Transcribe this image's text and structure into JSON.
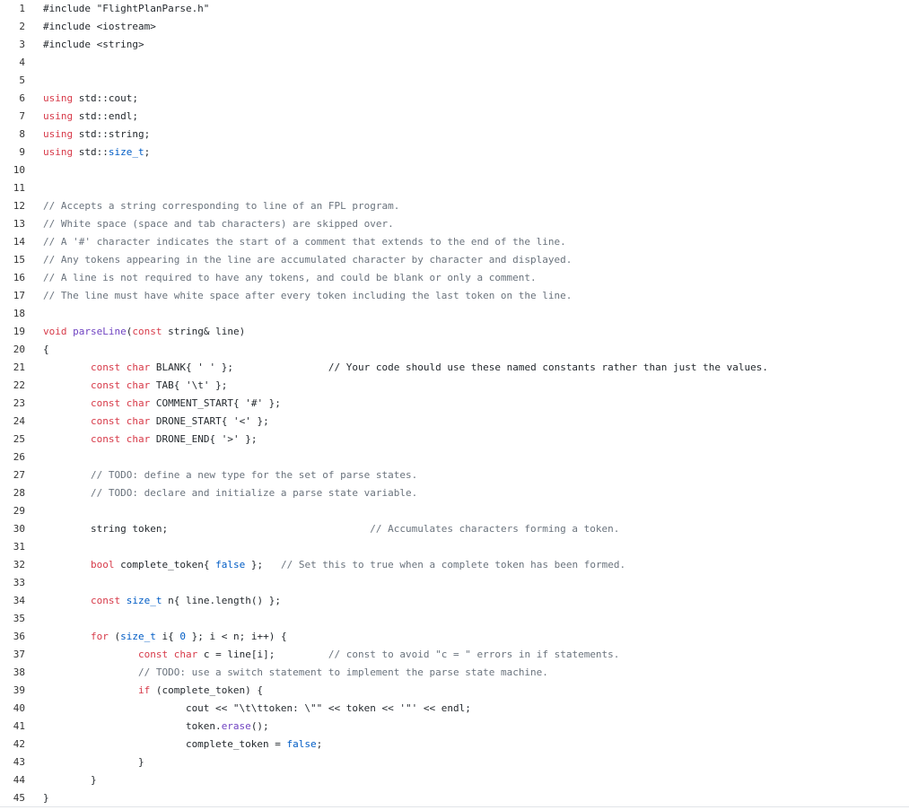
{
  "lines": [
    {
      "n": "1",
      "segs": [
        {
          "t": "#include \"FlightPlanParse.h\"",
          "c": "st"
        }
      ]
    },
    {
      "n": "2",
      "segs": [
        {
          "t": "#include <iostream>",
          "c": "st"
        }
      ]
    },
    {
      "n": "3",
      "segs": [
        {
          "t": "#include <string>",
          "c": "st"
        }
      ]
    },
    {
      "n": "4",
      "segs": []
    },
    {
      "n": "5",
      "segs": []
    },
    {
      "n": "6",
      "segs": [
        {
          "t": "using",
          "c": "kw"
        },
        {
          "t": " std::cout;",
          "c": "st"
        }
      ]
    },
    {
      "n": "7",
      "segs": [
        {
          "t": "using",
          "c": "kw"
        },
        {
          "t": " std::endl;",
          "c": "st"
        }
      ]
    },
    {
      "n": "8",
      "segs": [
        {
          "t": "using",
          "c": "kw"
        },
        {
          "t": " std::string;",
          "c": "st"
        }
      ]
    },
    {
      "n": "9",
      "segs": [
        {
          "t": "using",
          "c": "kw"
        },
        {
          "t": " std::",
          "c": "st"
        },
        {
          "t": "size_t",
          "c": "bl"
        },
        {
          "t": ";",
          "c": "st"
        }
      ]
    },
    {
      "n": "10",
      "segs": []
    },
    {
      "n": "11",
      "segs": []
    },
    {
      "n": "12",
      "segs": [
        {
          "t": "// Accepts a string corresponding to line of an FPL program.",
          "c": "cm"
        }
      ]
    },
    {
      "n": "13",
      "segs": [
        {
          "t": "// White space (space and tab characters) are skipped over.",
          "c": "cm"
        }
      ]
    },
    {
      "n": "14",
      "segs": [
        {
          "t": "// A '#' character indicates the start of a comment that extends to the end of the line.",
          "c": "cm"
        }
      ]
    },
    {
      "n": "15",
      "segs": [
        {
          "t": "// Any tokens appearing in the line are accumulated character by character and displayed.",
          "c": "cm"
        }
      ]
    },
    {
      "n": "16",
      "segs": [
        {
          "t": "// A line is not required to have any tokens, and could be blank or only a comment.",
          "c": "cm"
        }
      ]
    },
    {
      "n": "17",
      "segs": [
        {
          "t": "// The line must have white space after every token including the last token on the line.",
          "c": "cm"
        }
      ]
    },
    {
      "n": "18",
      "segs": []
    },
    {
      "n": "19",
      "segs": [
        {
          "t": "void",
          "c": "kw"
        },
        {
          "t": " ",
          "c": "st"
        },
        {
          "t": "parseLine",
          "c": "fn"
        },
        {
          "t": "(",
          "c": "st"
        },
        {
          "t": "const",
          "c": "kw"
        },
        {
          "t": " string& line)",
          "c": "st"
        }
      ]
    },
    {
      "n": "20",
      "segs": [
        {
          "t": "{",
          "c": "st"
        }
      ]
    },
    {
      "n": "21",
      "segs": [
        {
          "t": "        ",
          "c": "st"
        },
        {
          "t": "const",
          "c": "kw"
        },
        {
          "t": " ",
          "c": "st"
        },
        {
          "t": "char",
          "c": "kw"
        },
        {
          "t": " BLANK{ ' ' };                // Your code should use these named constants rather than just the values.",
          "c": "st"
        }
      ]
    },
    {
      "n": "22",
      "segs": [
        {
          "t": "        ",
          "c": "st"
        },
        {
          "t": "const",
          "c": "kw"
        },
        {
          "t": " ",
          "c": "st"
        },
        {
          "t": "char",
          "c": "kw"
        },
        {
          "t": " TAB{ '\\t' };",
          "c": "st"
        }
      ]
    },
    {
      "n": "23",
      "segs": [
        {
          "t": "        ",
          "c": "st"
        },
        {
          "t": "const",
          "c": "kw"
        },
        {
          "t": " ",
          "c": "st"
        },
        {
          "t": "char",
          "c": "kw"
        },
        {
          "t": " COMMENT_START{ '#' };",
          "c": "st"
        }
      ]
    },
    {
      "n": "24",
      "segs": [
        {
          "t": "        ",
          "c": "st"
        },
        {
          "t": "const",
          "c": "kw"
        },
        {
          "t": " ",
          "c": "st"
        },
        {
          "t": "char",
          "c": "kw"
        },
        {
          "t": " DRONE_START{ '<' };",
          "c": "st"
        }
      ]
    },
    {
      "n": "25",
      "segs": [
        {
          "t": "        ",
          "c": "st"
        },
        {
          "t": "const",
          "c": "kw"
        },
        {
          "t": " ",
          "c": "st"
        },
        {
          "t": "char",
          "c": "kw"
        },
        {
          "t": " DRONE_END{ '>' };",
          "c": "st"
        }
      ]
    },
    {
      "n": "26",
      "segs": []
    },
    {
      "n": "27",
      "segs": [
        {
          "t": "        ",
          "c": "st"
        },
        {
          "t": "// TODO: define a new type for the set of parse states.",
          "c": "cm"
        }
      ]
    },
    {
      "n": "28",
      "segs": [
        {
          "t": "        ",
          "c": "st"
        },
        {
          "t": "// TODO: declare and initialize a parse state variable.",
          "c": "cm"
        }
      ]
    },
    {
      "n": "29",
      "segs": []
    },
    {
      "n": "30",
      "segs": [
        {
          "t": "        string token;                                  ",
          "c": "st"
        },
        {
          "t": "// Accumulates characters forming a token.",
          "c": "cm"
        }
      ]
    },
    {
      "n": "31",
      "segs": []
    },
    {
      "n": "32",
      "segs": [
        {
          "t": "        ",
          "c": "st"
        },
        {
          "t": "bool",
          "c": "kw"
        },
        {
          "t": " complete_token{ ",
          "c": "st"
        },
        {
          "t": "false",
          "c": "bl"
        },
        {
          "t": " };   ",
          "c": "st"
        },
        {
          "t": "// Set this to true when a complete token has been formed.",
          "c": "cm"
        }
      ]
    },
    {
      "n": "33",
      "segs": []
    },
    {
      "n": "34",
      "segs": [
        {
          "t": "        ",
          "c": "st"
        },
        {
          "t": "const",
          "c": "kw"
        },
        {
          "t": " ",
          "c": "st"
        },
        {
          "t": "size_t",
          "c": "bl"
        },
        {
          "t": " n{ line.length() };",
          "c": "st"
        }
      ]
    },
    {
      "n": "35",
      "segs": []
    },
    {
      "n": "36",
      "segs": [
        {
          "t": "        ",
          "c": "st"
        },
        {
          "t": "for",
          "c": "kw"
        },
        {
          "t": " (",
          "c": "st"
        },
        {
          "t": "size_t",
          "c": "bl"
        },
        {
          "t": " i{ ",
          "c": "st"
        },
        {
          "t": "0",
          "c": "bl"
        },
        {
          "t": " }; i < n; i++) {",
          "c": "st"
        }
      ]
    },
    {
      "n": "37",
      "segs": [
        {
          "t": "                ",
          "c": "st"
        },
        {
          "t": "const",
          "c": "kw"
        },
        {
          "t": " ",
          "c": "st"
        },
        {
          "t": "char",
          "c": "kw"
        },
        {
          "t": " c = line[i];         ",
          "c": "st"
        },
        {
          "t": "// const to avoid \"c = \" errors in if statements.",
          "c": "cm"
        }
      ]
    },
    {
      "n": "38",
      "segs": [
        {
          "t": "                ",
          "c": "st"
        },
        {
          "t": "// TODO: use a switch statement to implement the parse state machine.",
          "c": "cm"
        }
      ]
    },
    {
      "n": "39",
      "segs": [
        {
          "t": "                ",
          "c": "st"
        },
        {
          "t": "if",
          "c": "kw"
        },
        {
          "t": " (complete_token) {",
          "c": "st"
        }
      ]
    },
    {
      "n": "40",
      "segs": [
        {
          "t": "                        cout << \"\\t\\ttoken: \\\"\" << token << '\"' << endl;",
          "c": "st"
        }
      ]
    },
    {
      "n": "41",
      "segs": [
        {
          "t": "                        token.",
          "c": "st"
        },
        {
          "t": "erase",
          "c": "fn"
        },
        {
          "t": "();",
          "c": "st"
        }
      ]
    },
    {
      "n": "42",
      "segs": [
        {
          "t": "                        complete_token = ",
          "c": "st"
        },
        {
          "t": "false",
          "c": "bl"
        },
        {
          "t": ";",
          "c": "st"
        }
      ]
    },
    {
      "n": "43",
      "segs": [
        {
          "t": "                }",
          "c": "st"
        }
      ]
    },
    {
      "n": "44",
      "segs": [
        {
          "t": "        }",
          "c": "st"
        }
      ]
    },
    {
      "n": "45",
      "segs": [
        {
          "t": "}",
          "c": "st"
        }
      ]
    }
  ]
}
